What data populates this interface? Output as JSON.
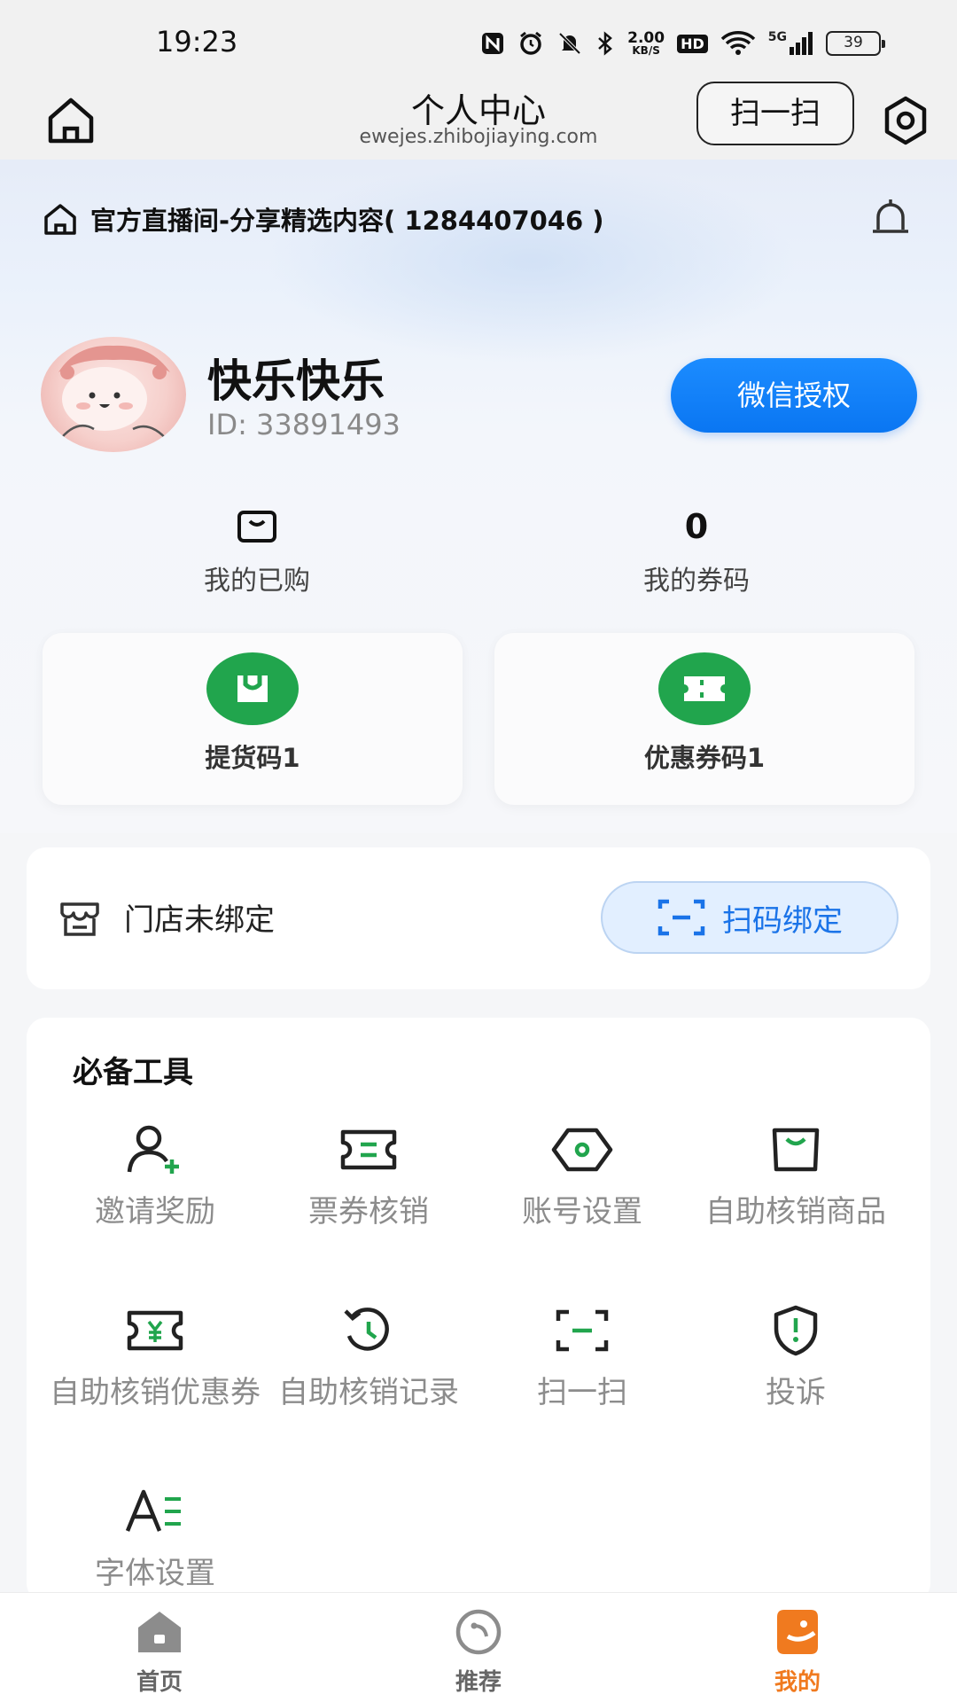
{
  "status_bar": {
    "time": "19:23",
    "net_speed_value": "2.00",
    "net_speed_unit": "KB/S",
    "hd_label": "HD",
    "network_label": "5G",
    "battery": "39"
  },
  "top_nav": {
    "title": "个人中心",
    "url": "ewejes.zhibojiaying.com",
    "scan_label": "扫一扫"
  },
  "live_room": {
    "name": "官方直播间-分享精选内容( 1284407046 )"
  },
  "profile": {
    "username": "快乐快乐",
    "user_id": "ID: 33891493",
    "wechat_button": "微信授权"
  },
  "stats": {
    "purchased_label": "我的已购",
    "coupons_value": "0",
    "coupons_label": "我的券码"
  },
  "codes": {
    "pickup_label": "提货码1",
    "coupon_label": "优惠券码1"
  },
  "store": {
    "status_label": "门店未绑定",
    "bind_button": "扫码绑定"
  },
  "tools": {
    "title": "必备工具",
    "items": [
      {
        "label": "邀请奖励",
        "icon": "invite-user-icon"
      },
      {
        "label": "票券核销",
        "icon": "ticket-icon"
      },
      {
        "label": "账号设置",
        "icon": "account-settings-icon"
      },
      {
        "label": "自助核销商品",
        "icon": "bag-icon"
      },
      {
        "label": "自助核销优惠券",
        "icon": "yuan-coupon-icon"
      },
      {
        "label": "自助核销记录",
        "icon": "history-icon"
      },
      {
        "label": "扫一扫",
        "icon": "scan-icon"
      },
      {
        "label": "投诉",
        "icon": "complaint-icon"
      },
      {
        "label": "字体设置",
        "icon": "font-settings-icon"
      }
    ]
  },
  "tab_bar": {
    "items": [
      {
        "label": "首页",
        "icon": "home-icon",
        "active": false
      },
      {
        "label": "推荐",
        "icon": "recommend-icon",
        "active": false
      },
      {
        "label": "我的",
        "icon": "mine-icon",
        "active": true
      }
    ]
  },
  "colors": {
    "accent_blue": "#0a76f2",
    "accent_green": "#21a54d",
    "active_tab_orange": "#f07a1f"
  }
}
